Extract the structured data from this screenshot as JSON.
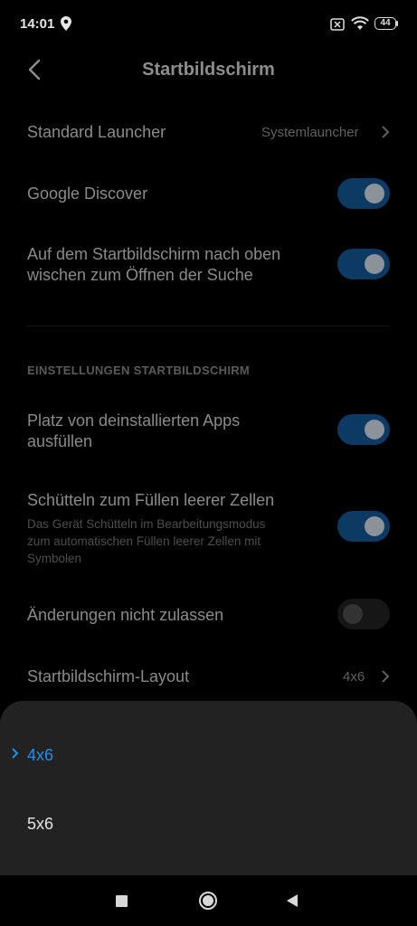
{
  "status_bar": {
    "time": "14:01",
    "battery": "44"
  },
  "header": {
    "title": "Startbildschirm"
  },
  "settings": {
    "default_launcher": {
      "label": "Standard Launcher",
      "value": "Systemlauncher"
    },
    "google_discover": {
      "label": "Google Discover",
      "enabled": true
    },
    "swipe_search": {
      "label_line1": "Auf dem Startbildschirm nach oben",
      "label_line2": "wischen zum Öffnen der Suche",
      "enabled": true
    },
    "section_header": "EINSTELLUNGEN STARTBILDSCHIRM",
    "fill_uninstalled": {
      "label_line1": "Platz von deinstallierten Apps",
      "label_line2": "ausfüllen",
      "enabled": true
    },
    "shake_fill": {
      "label": "Schütteln zum Füllen leerer Zellen",
      "desc_line1": "Das Gerät Schütteln im Bearbeitungsmodus",
      "desc_line2": "zum automatischen Füllen leerer Zellen mit",
      "desc_line3": "Symbolen",
      "enabled": true
    },
    "lock_changes": {
      "label": "Änderungen nicht zulassen",
      "enabled": false
    },
    "layout": {
      "label": "Startbildschirm-Layout",
      "value": "4x6"
    }
  },
  "layout_popup": {
    "options": [
      "4x6",
      "5x6"
    ],
    "selected": "4x6"
  },
  "colors": {
    "accent": "#1f8ef1",
    "toggle_on": "#0c3a63",
    "sheet_bg": "#222222"
  }
}
